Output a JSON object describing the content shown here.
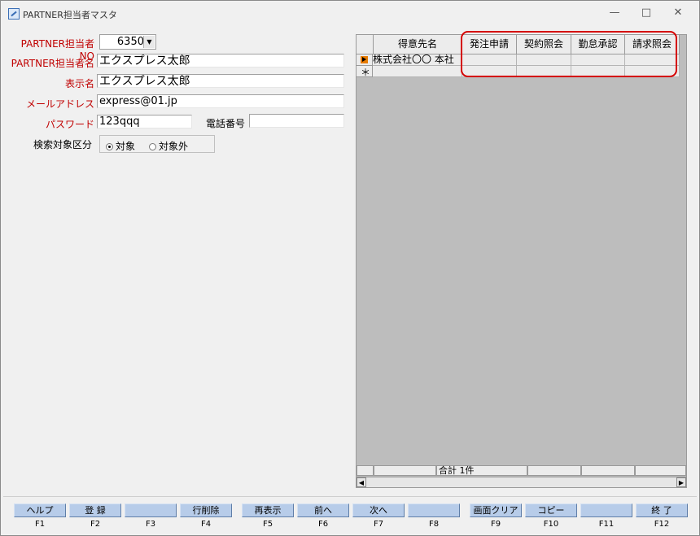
{
  "window": {
    "title": "PARTNER担当者マスタ",
    "minimize": "—",
    "maximize": "□",
    "close": "✕"
  },
  "form": {
    "partner_no_label": "PARTNER担当者NO",
    "partner_no_value": "6350",
    "partner_name_label": "PARTNER担当者名",
    "partner_name_value": "エクスプレス太郎",
    "display_name_label": "表示名",
    "display_name_value": "エクスプレス太郎",
    "email_label": "メールアドレス",
    "email_value": "express@01.jp",
    "password_label": "パスワード",
    "password_value": "123qqq",
    "phone_label": "電話番号",
    "phone_value": "",
    "search_target_label": "検索対象区分",
    "radio_target": "対象",
    "radio_non_target": "対象外"
  },
  "grid": {
    "columns": [
      "得意先名",
      "発注申請",
      "契約照会",
      "勤怠承認",
      "請求照会"
    ],
    "rows": [
      {
        "cells": [
          "株式会社〇〇 本社",
          "",
          "",
          "",
          ""
        ]
      }
    ],
    "new_row_marker": "＊",
    "footer_total": "合計 1件"
  },
  "fkeys": [
    {
      "label": "ヘルプ",
      "key": "F1"
    },
    {
      "label": "登 録",
      "key": "F2"
    },
    {
      "label": "",
      "key": "F3"
    },
    {
      "label": "行削除",
      "key": "F4"
    },
    {
      "label": "再表示",
      "key": "F5"
    },
    {
      "label": "前へ",
      "key": "F6"
    },
    {
      "label": "次へ",
      "key": "F7"
    },
    {
      "label": "",
      "key": "F8"
    },
    {
      "label": "画面クリア",
      "key": "F9"
    },
    {
      "label": "コピー",
      "key": "F10"
    },
    {
      "label": "",
      "key": "F11"
    },
    {
      "label": "終 了",
      "key": "F12"
    }
  ],
  "colors": {
    "label_red": "#c00000",
    "highlight": "#d40000",
    "fkey_button": "#b7cce9",
    "grid_background": "#bdbdbd"
  }
}
